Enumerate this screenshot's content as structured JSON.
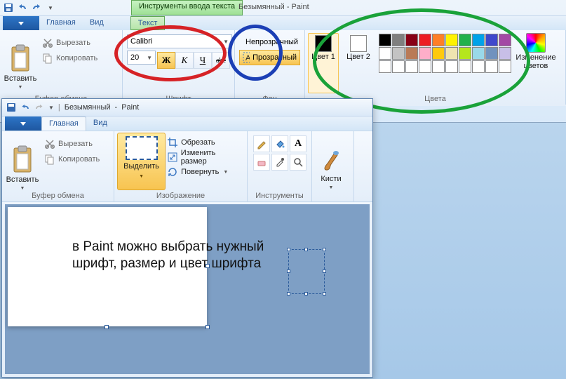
{
  "app": {
    "title_doc": "Безымянный",
    "title_app": "Paint",
    "title_sep": " - ",
    "textTools": "Инструменты ввода текста",
    "textTab": "Текст"
  },
  "tabs": {
    "home": "Главная",
    "view": "Вид"
  },
  "clipboard": {
    "group": "Буфер обмена",
    "paste": "Вставить",
    "cut": "Вырезать",
    "copy": "Копировать"
  },
  "font": {
    "group": "Шрифт",
    "family": "Calibri",
    "size": "20",
    "bold": "Ж",
    "italic": "К",
    "underline": "Ч",
    "strike": "abc"
  },
  "bg": {
    "group": "Фон",
    "opaque": "Непрозрачный",
    "transparent": "Прозрачный"
  },
  "colors": {
    "group": "Цвета",
    "c1": "Цвет 1",
    "c2": "Цвет 2",
    "edit": "Изменение цветов",
    "color1": "#000000",
    "color2": "#ffffff",
    "palette": [
      "#000000",
      "#7f7f7f",
      "#880015",
      "#ed1c24",
      "#ff7f27",
      "#fff200",
      "#22b14c",
      "#00a2e8",
      "#3f48cc",
      "#a349a4",
      "#ffffff",
      "#c3c3c3",
      "#b97a57",
      "#ffaec9",
      "#ffc90e",
      "#efe4b0",
      "#b5e61d",
      "#99d9ea",
      "#7092be",
      "#c8bfe7",
      "#ffffff",
      "#ffffff",
      "#ffffff",
      "#ffffff",
      "#ffffff",
      "#ffffff",
      "#ffffff",
      "#ffffff",
      "#ffffff",
      "#ffffff"
    ]
  },
  "win2": {
    "title_doc": "Безымянный",
    "title_app": "Paint"
  },
  "image": {
    "group": "Изображение",
    "select": "Выделить",
    "crop": "Обрезать",
    "resize": "Изменить размер",
    "rotate": "Повернуть"
  },
  "tools": {
    "group": "Инструменты"
  },
  "brushes": {
    "label": "Кисти"
  },
  "canvas_text": "в Paint можно выбрать нужный шрифт, размер и цвет шрифта"
}
